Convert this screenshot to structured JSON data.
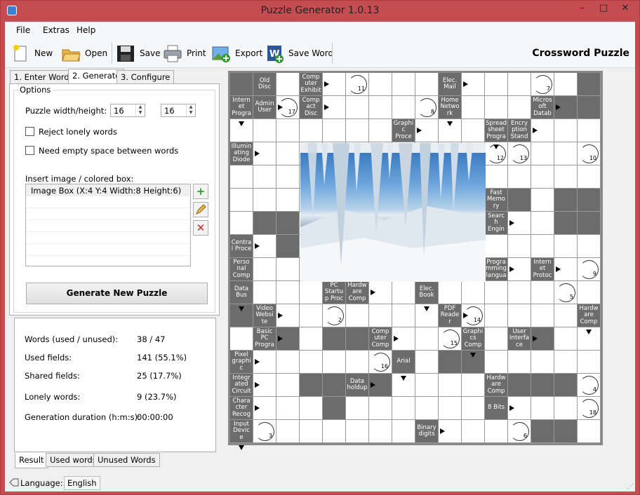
{
  "window": {
    "title": "Puzzle Generator 1.0.13",
    "min": "–",
    "max": "□",
    "close": "✕"
  },
  "menu": [
    "File",
    "Extras",
    "Help"
  ],
  "toolbar": {
    "new": "New",
    "open": "Open",
    "save": "Save",
    "print": "Print",
    "export": "Export",
    "save_word": "Save Word",
    "heading": "Crossword Puzzle"
  },
  "tabs": [
    "1. Enter Words",
    "2. Generate",
    "3. Configure"
  ],
  "options": {
    "group_label": "Options",
    "size_label": "Puzzle width/height:",
    "width": "16",
    "height": "16",
    "reject_lonely": "Reject lonely words",
    "need_space": "Need empty space between words",
    "insert_label": "Insert image / colored box:",
    "list_items": [
      "Image Box (X:4 Y:4 Width:8 Height:6)"
    ],
    "generate": "Generate New Puzzle"
  },
  "stats": [
    {
      "label": "Words (used / unused):",
      "value": "38 / 47"
    },
    {
      "label": "Used fields:",
      "value": "141 (55.1%)"
    },
    {
      "label": "Shared fields:",
      "value": "25 (17.7%)"
    },
    {
      "label": "Lonely words:",
      "value": "9 (23.7%)"
    },
    {
      "label": "Generation duration (h:m:s):",
      "value": "00:00:00"
    }
  ],
  "bottom_tabs": [
    "Result",
    "Used words",
    "Unused Words"
  ],
  "status": {
    "language_label": "Language:",
    "language": "English"
  },
  "puzzle": {
    "clues": [
      {
        "r": 0,
        "c": 1,
        "t": "Old Disc"
      },
      {
        "r": 0,
        "c": 3,
        "t": "Comp uter Exhibit"
      },
      {
        "r": 0,
        "c": 9,
        "t": "Elec. Mail"
      },
      {
        "r": 1,
        "c": 0,
        "t": "Intern et Progra"
      },
      {
        "r": 1,
        "c": 1,
        "t": "Admin User"
      },
      {
        "r": 1,
        "c": 3,
        "t": "Comp act Disc"
      },
      {
        "r": 1,
        "c": 9,
        "t": "Home Netwo rk"
      },
      {
        "r": 1,
        "c": 13,
        "t": "Micros oft Datab"
      },
      {
        "r": 2,
        "c": 7,
        "t": "Graphi c Proce"
      },
      {
        "r": 2,
        "c": 11,
        "t": "Spread sheet Progra"
      },
      {
        "r": 2,
        "c": 12,
        "t": "Encry ption Stand"
      },
      {
        "r": 3,
        "c": 0,
        "t": "Illumin ating Diode"
      },
      {
        "r": 5,
        "c": 11,
        "t": "Fast Memo ry"
      },
      {
        "r": 6,
        "c": 11,
        "t": "Searc h Engin"
      },
      {
        "r": 7,
        "c": 0,
        "t": "Centra l Proce"
      },
      {
        "r": 8,
        "c": 0,
        "t": "Perso nal Comp"
      },
      {
        "r": 8,
        "c": 11,
        "t": "Progra mming langua"
      },
      {
        "r": 8,
        "c": 13,
        "t": "Intern et Protoc"
      },
      {
        "r": 9,
        "c": 0,
        "t": "Data Bus"
      },
      {
        "r": 9,
        "c": 4,
        "t": "PC Startu p Proc"
      },
      {
        "r": 9,
        "c": 5,
        "t": "Hardw are Comp"
      },
      {
        "r": 9,
        "c": 8,
        "t": "Elec. Book"
      },
      {
        "r": 10,
        "c": 1,
        "t": "Video Websi te"
      },
      {
        "r": 10,
        "c": 9,
        "t": "PDF Reade r"
      },
      {
        "r": 10,
        "c": 15,
        "t": "Hardw are Comp"
      },
      {
        "r": 11,
        "c": 1,
        "t": "Basic PC Progra"
      },
      {
        "r": 11,
        "c": 6,
        "t": "Comp uter Comp"
      },
      {
        "r": 11,
        "c": 10,
        "t": "Graphi cs Comp"
      },
      {
        "r": 11,
        "c": 12,
        "t": "User Interfa ce"
      },
      {
        "r": 12,
        "c": 0,
        "t": "Pixel graphi c"
      },
      {
        "r": 12,
        "c": 7,
        "t": "Arial"
      },
      {
        "r": 13,
        "c": 0,
        "t": "Integr ated Circuit"
      },
      {
        "r": 13,
        "c": 5,
        "t": "Data holdup"
      },
      {
        "r": 13,
        "c": 11,
        "t": "Hardw are Comp"
      },
      {
        "r": 14,
        "c": 0,
        "t": "Chara cter Recog"
      },
      {
        "r": 14,
        "c": 11,
        "t": "8 Bits"
      },
      {
        "r": 15,
        "c": 0,
        "t": "Input Devic e"
      },
      {
        "r": 15,
        "c": 8,
        "t": "Binary digits"
      }
    ],
    "dark": [
      [
        0,
        0
      ],
      [
        0,
        15
      ],
      [
        1,
        14
      ],
      [
        1,
        15
      ],
      [
        6,
        1
      ],
      [
        6,
        2
      ],
      [
        7,
        2
      ],
      [
        5,
        12
      ],
      [
        5,
        14
      ],
      [
        5,
        15
      ],
      [
        6,
        14
      ],
      [
        6,
        15
      ],
      [
        10,
        0
      ],
      [
        11,
        2
      ],
      [
        11,
        4
      ],
      [
        11,
        5
      ],
      [
        11,
        13
      ],
      [
        12,
        9
      ],
      [
        12,
        10
      ],
      [
        13,
        3
      ],
      [
        13,
        4
      ],
      [
        13,
        6
      ],
      [
        13,
        12
      ],
      [
        13,
        13
      ],
      [
        13,
        14
      ],
      [
        14,
        4
      ],
      [
        15,
        13
      ],
      [
        15,
        14
      ]
    ],
    "numbers": [
      {
        "r": 0,
        "c": 5,
        "n": "11"
      },
      {
        "r": 0,
        "c": 13,
        "n": "7"
      },
      {
        "r": 1,
        "c": 2,
        "n": "17"
      },
      {
        "r": 1,
        "c": 8,
        "n": "8"
      },
      {
        "r": 3,
        "c": 11,
        "n": "12"
      },
      {
        "r": 3,
        "c": 12,
        "n": "13"
      },
      {
        "r": 3,
        "c": 15,
        "n": "10"
      },
      {
        "r": 8,
        "c": 15,
        "n": "9"
      },
      {
        "r": 9,
        "c": 14,
        "n": "5"
      },
      {
        "r": 10,
        "c": 4,
        "n": "2"
      },
      {
        "r": 10,
        "c": 10,
        "n": "14"
      },
      {
        "r": 11,
        "c": 9,
        "n": "15"
      },
      {
        "r": 12,
        "c": 6,
        "n": "16"
      },
      {
        "r": 13,
        "c": 15,
        "n": "4"
      },
      {
        "r": 14,
        "c": 15,
        "n": "18"
      },
      {
        "r": 15,
        "c": 1,
        "n": "3"
      },
      {
        "r": 15,
        "c": 12,
        "n": "6"
      }
    ]
  }
}
